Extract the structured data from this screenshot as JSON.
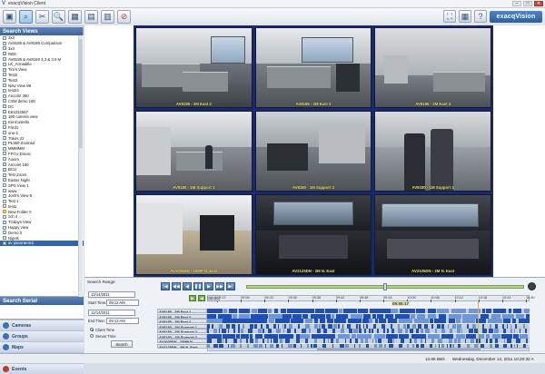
{
  "window": {
    "title": "exacqVision Client",
    "logo_letter": "V",
    "controls": {
      "min": "–",
      "max": "□",
      "close": "✕"
    }
  },
  "toolbar": {
    "buttons": [
      {
        "name": "live-view-icon",
        "glyph": "▣"
      },
      {
        "name": "search-icon",
        "glyph": "⌕"
      },
      {
        "name": "config-tools-icon",
        "glyph": "✂"
      },
      {
        "name": "zoom-icon",
        "glyph": "🔍"
      },
      {
        "name": "layout-1-icon",
        "glyph": "▦"
      },
      {
        "name": "layout-2-icon",
        "glyph": "▤"
      },
      {
        "name": "layout-3-icon",
        "glyph": "▥"
      },
      {
        "name": "stop-icon",
        "glyph": "⊘"
      }
    ],
    "right_buttons": [
      {
        "name": "fullscreen-icon",
        "glyph": "⛶"
      },
      {
        "name": "layout-view-icon",
        "glyph": "▦"
      },
      {
        "name": "help-icon",
        "glyph": "?"
      }
    ],
    "brand": "exacqVision"
  },
  "sidebar": {
    "search_views_title": "Search Views",
    "views": [
      {
        "label": "3x3",
        "folder": false
      },
      {
        "label": "AV8185 & AV8180 Comparison",
        "folder": false
      },
      {
        "label": "3x3",
        "folder": false
      },
      {
        "label": "RBS",
        "folder": false
      },
      {
        "label": "AV8185 & AV8180 3,3 & 3.0 M",
        "folder": false
      },
      {
        "label": "LK_Armadillo",
        "folder": false
      },
      {
        "label": "Tim's View",
        "folder": false
      },
      {
        "label": "Test2",
        "folder": false
      },
      {
        "label": "Test3",
        "folder": false
      },
      {
        "label": "New View 99",
        "folder": false
      },
      {
        "label": "test24",
        "folder": false
      },
      {
        "label": "Ancoint 360",
        "folder": false
      },
      {
        "label": "CSM demo 180",
        "folder": false
      },
      {
        "label": "DC",
        "folder": false
      },
      {
        "label": "E61234567",
        "folder": false
      },
      {
        "label": "180 camera view",
        "folder": false
      },
      {
        "label": "KenCostello",
        "folder": false
      },
      {
        "label": "Fred1",
        "folder": false
      },
      {
        "label": "one-1",
        "folder": false
      },
      {
        "label": "Travis 22",
        "folder": false
      },
      {
        "label": "PL360 Zoomed",
        "folder": false
      },
      {
        "label": "MMMMM",
        "folder": false
      },
      {
        "label": "FFCU Dinosi",
        "folder": false
      },
      {
        "label": "Axiom",
        "folder": false
      },
      {
        "label": "Ancoint 180",
        "folder": false
      },
      {
        "label": "BCU",
        "folder": false
      },
      {
        "label": "Test Zoom",
        "folder": false
      },
      {
        "label": "Easter Night",
        "folder": false
      },
      {
        "label": "SPS View 1",
        "folder": false
      },
      {
        "label": "www",
        "folder": false
      },
      {
        "label": "Josh's View 8",
        "folder": false
      },
      {
        "label": "Test 1",
        "folder": false
      },
      {
        "label": "test1",
        "folder": false
      },
      {
        "label": "New Folder 0",
        "folder": true
      },
      {
        "label": "zch 4",
        "folder": false
      },
      {
        "label": "TOdays View",
        "folder": false
      },
      {
        "label": "Happy view",
        "folder": false
      },
      {
        "label": "Demo 3",
        "folder": false
      },
      {
        "label": "Nigels",
        "folder": false
      },
      {
        "label": "av panoramics",
        "folder": false
      }
    ],
    "selected_index": 39,
    "search_serial_title": "Search Serial",
    "nav": [
      {
        "label": "Cameras",
        "color": "#3b6fb6",
        "active": false
      },
      {
        "label": "Groups",
        "color": "#3b6fb6",
        "active": false
      },
      {
        "label": "Maps",
        "color": "#3b6fb6",
        "active": false
      },
      {
        "label": "Views",
        "color": "#e8941a",
        "active": true
      },
      {
        "label": "Events",
        "color": "#c0392b",
        "active": false
      }
    ]
  },
  "cameras": [
    {
      "caption": "AV8185 - 2M East 2",
      "scene": "office"
    },
    {
      "caption": "AV8185 - 2M East 3",
      "scene": "office2"
    },
    {
      "caption": "AV8185 - 2M East 4",
      "scene": "office3"
    },
    {
      "caption": "AV8180 - 1M Support 1",
      "scene": "hall"
    },
    {
      "caption": "AV8180 - 1M Support 2",
      "scene": "hall2"
    },
    {
      "caption": "AV8180 - 1M Support 3",
      "scene": "people"
    },
    {
      "caption": "AV1005DN - 10MP N. East",
      "scene": "entry"
    },
    {
      "caption": "AV2125DN - 2M N. East",
      "scene": "dark"
    },
    {
      "caption": "AV2125DN - 2M N. East",
      "scene": "dark2"
    }
  ],
  "search": {
    "range_label": "Search Range",
    "start_date": "12/14/2011",
    "start_time_label": "Start Time:",
    "start_time": "09:12 AM",
    "end_date": "12/14/2011",
    "end_time_label": "End Time:",
    "end_time": "09:13 AM",
    "client_time": "Client Time",
    "server_time": "Server Time",
    "search_button": "Search"
  },
  "playback": {
    "buttons": [
      "|◀",
      "◀◀",
      "◀",
      "❚❚",
      "▶",
      "▶▶",
      "▶|"
    ],
    "speed_level": 0.5
  },
  "timeline": {
    "nav": [
      "▶",
      "◀",
      "00:00"
    ],
    "ticks": [
      "09:12",
      "09:06",
      "09:24",
      "09:30",
      "09:36",
      "09:42",
      "09:48",
      "09:54",
      "10:00",
      "10:06",
      "10:12",
      "10:18",
      "10:24",
      "10:30"
    ],
    "current_time": "09:55:17",
    "rows": [
      "AV8185 - 2M East 2",
      "AV8185 - 2M East 3",
      "AV8185 - 2M East 4",
      "AV8180 - 1M Support 1",
      "AV8180 - 1M Support 2",
      "AV8180 - 1M Support 3",
      "AV1005DN - 10MP N.",
      "AV2125DN - 2M N. East"
    ]
  },
  "status": {
    "rate": "13.85 kB/s",
    "datetime": "Wednesday, December 14, 2011 10:20:32 A"
  }
}
